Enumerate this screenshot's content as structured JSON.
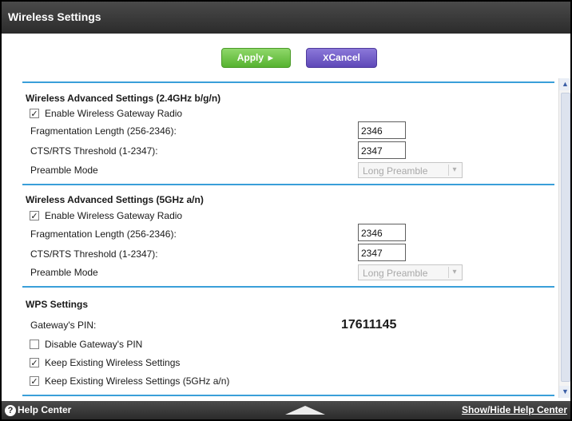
{
  "window": {
    "title": "Wireless Settings"
  },
  "actions": {
    "apply_label": "Apply",
    "apply_icon": "►",
    "cancel_label": "Cancel",
    "cancel_icon": "X"
  },
  "sections": {
    "wifi24": {
      "title": "Wireless Advanced Settings (2.4GHz b/g/n)",
      "enable_radio_label": "Enable Wireless Gateway Radio",
      "enable_radio_checked": true,
      "frag_label": "Fragmentation Length (256-2346):",
      "frag_value": "2346",
      "cts_label": "CTS/RTS Threshold (1-2347):",
      "cts_value": "2347",
      "preamble_label": "Preamble Mode",
      "preamble_value": "Long Preamble"
    },
    "wifi5": {
      "title": "Wireless Advanced Settings (5GHz a/n)",
      "enable_radio_label": "Enable Wireless Gateway Radio",
      "enable_radio_checked": true,
      "frag_label": "Fragmentation Length (256-2346):",
      "frag_value": "2346",
      "cts_label": "CTS/RTS Threshold (1-2347):",
      "cts_value": "2347",
      "preamble_label": "Preamble Mode",
      "preamble_value": "Long Preamble"
    },
    "wps": {
      "title": "WPS Settings",
      "pin_label": "Gateway's PIN:",
      "pin_value": "17611145",
      "disable_pin_label": "Disable Gateway's PIN",
      "disable_pin_checked": false,
      "keep_existing_label": "Keep Existing Wireless Settings",
      "keep_existing_checked": true,
      "keep_existing_5g_label": "Keep Existing Wireless Settings (5GHz a/n)",
      "keep_existing_5g_checked": true
    }
  },
  "footer": {
    "help_left_label": "Help Center",
    "help_right_label": "Show/Hide Help Center"
  },
  "icons": {
    "help": "help-circle-icon",
    "toggle": "collapse-triangle-icon"
  },
  "colors": {
    "accent": "#3a9fd9",
    "apply": "#56b22f",
    "cancel": "#5e48b8",
    "bar": "#2b2b2b"
  }
}
